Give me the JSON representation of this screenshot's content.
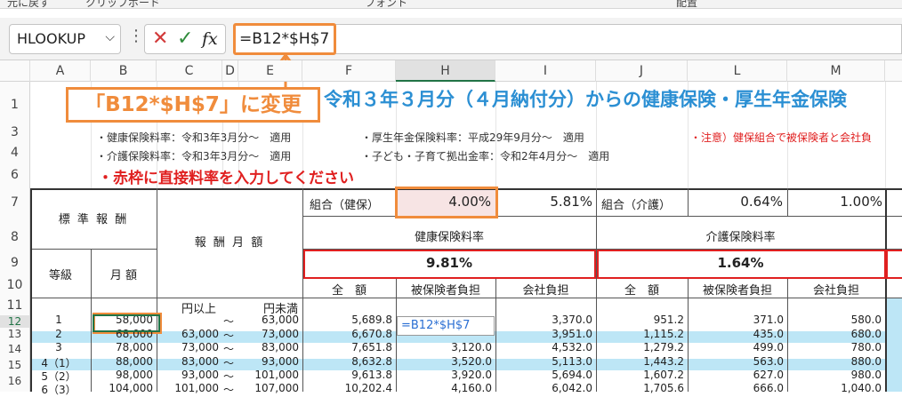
{
  "ribbon": {
    "groups": [
      "元に戻す",
      "クリップボード",
      "フォント",
      "配置"
    ]
  },
  "formula_bar": {
    "name_box": "HLOOKUP",
    "cancel_icon": "✕",
    "enter_icon": "✓",
    "fx_label": "fx",
    "formula": "=B12*$H$7"
  },
  "columns": [
    "A",
    "B",
    "C",
    "D",
    "E",
    "F",
    "H",
    "I",
    "J",
    "L",
    "M"
  ],
  "rows": [
    "1",
    "3",
    "4",
    "6",
    "7",
    "8",
    "9",
    "10",
    "11",
    "12",
    "13",
    "14",
    "15",
    "16"
  ],
  "sheet": {
    "title": "令和３年３月分（４月納付分）からの健康保険・厚生年金保険",
    "callout": "「B12*$H$7」に変更",
    "notes": {
      "health_rate": "・健康保険料率：令和3年3月分～　適用",
      "pension_rate": "・厚生年金保険料率：平成29年9月分～　適用",
      "caution": "・注意）健保組合で被保険者と会社負",
      "care_rate": "・介護保険料率：令和3年3月分～　適用",
      "child_rate": "・子ども・子育て拠出金率：令和2年4月分～　適用"
    },
    "red_note": "・赤枠に直接料率を入力してください",
    "headers": {
      "standard_reward": "標 準 報 酬",
      "reward_monthly": "報 酬 月 額",
      "grade": "等級",
      "monthly": "月 額",
      "kumiai_kenpo": "組合（健保）",
      "kumiai_kenpo_rate": "4.00%",
      "rate_581": "5.81%",
      "kumiai_kaigo": "組合（介護）",
      "kaigo_rate": "0.64%",
      "rate_100": "1.00%",
      "health_rate_label": "健康保険料率",
      "care_rate_label": "介護保険料率",
      "health_total_rate": "9.81%",
      "care_total_rate": "1.64%",
      "total_h": "全　額",
      "insured_h": "被保険者負担",
      "company_h": "会社負担",
      "total_c": "全　額",
      "insured_c": "被保険者負担",
      "company_c": "会社負担",
      "over": "円以上",
      "under": "円未満"
    },
    "editing_formula": "=B12*$H$7",
    "table_rows": [
      {
        "grade": "1",
        "monthly": "58,000",
        "low": "",
        "tilde": "～",
        "high": "63,000",
        "f": "5,689.8",
        "h": "",
        "i": "3,370.0",
        "j": "951.2",
        "l": "371.0",
        "m": "580.0"
      },
      {
        "grade": "2",
        "monthly": "68,000",
        "low": "63,000",
        "tilde": "～",
        "high": "73,000",
        "f": "6,670.8",
        "h": "",
        "i": "3,951.0",
        "j": "1,115.2",
        "l": "435.0",
        "m": "680.0"
      },
      {
        "grade": "3",
        "monthly": "78,000",
        "low": "73,000",
        "tilde": "～",
        "high": "83,000",
        "f": "7,651.8",
        "h": "3,120.0",
        "i": "4,532.0",
        "j": "1,279.2",
        "l": "499.0",
        "m": "780.0"
      },
      {
        "grade": "4（1）",
        "monthly": "88,000",
        "low": "83,000",
        "tilde": "～",
        "high": "93,000",
        "f": "8,632.8",
        "h": "3,520.0",
        "i": "5,113.0",
        "j": "1,443.2",
        "l": "563.0",
        "m": "880.0"
      },
      {
        "grade": "5（2）",
        "monthly": "98,000",
        "low": "93,000",
        "tilde": "～",
        "high": "101,000",
        "f": "9,613.8",
        "h": "3,920.0",
        "i": "5,694.0",
        "j": "1,607.2",
        "l": "627.0",
        "m": "980.0"
      },
      {
        "grade": "6（3）",
        "monthly": "104,000",
        "low": "101,000",
        "tilde": "～",
        "high": "107,000",
        "f": "10,202.4",
        "h": "4,160.0",
        "i": "6,042.0",
        "j": "1,705.6",
        "l": "666.0",
        "m": "1,040.0"
      }
    ]
  },
  "colors": {
    "accent_orange": "#f08c3c",
    "title_blue": "#2b8fd3",
    "warning_red": "#e02020",
    "band_blue": "#bde6f6",
    "excel_green": "#217346"
  }
}
